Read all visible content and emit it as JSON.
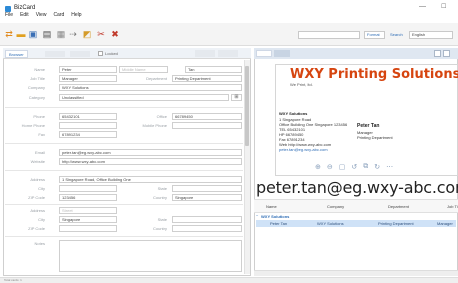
{
  "window": {
    "title": "BizCard",
    "minimize": "—",
    "maximize": "☐"
  },
  "menu": [
    "File",
    "Edit",
    "View",
    "Card",
    "Help"
  ],
  "toolbar": {
    "dropdown_value": "",
    "toggle_label": "Format",
    "search_label": "Search",
    "language": "English"
  },
  "left_tabs": [
    {
      "label": "Browser",
      "active": true
    },
    {
      "label": "",
      "active": false
    },
    {
      "label": "",
      "active": false
    },
    {
      "label": "Locked",
      "active": false
    }
  ],
  "form": {
    "name_label": "Name",
    "first_name": "Peter",
    "middle_name_placeholder": "Middle Name",
    "last_name": "Tan",
    "job_title_label": "Job Title",
    "job_title": "Manager",
    "department_label": "Department",
    "department": "Printing Department",
    "company_label": "Company",
    "company": "WXY Solutions",
    "category_label": "Category",
    "category": "Unclassified",
    "phone_label": "Phone",
    "phone": "65432101",
    "office_label": "Office",
    "office": "66789450",
    "home_phone_label": "Home Phone",
    "mobile_label": "Mobile Phone",
    "fax_label": "Fax",
    "fax": "67891234",
    "email_label": "Email",
    "email": "peter.tan@eg.wxy-abc.com",
    "website_label": "Website",
    "website": "http://www.wxy-abc.com",
    "address_label": "Address",
    "address": "1 Singapore Road, Office Building One",
    "city_label": "City",
    "state_label": "State",
    "zip_label": "ZIP Code",
    "zip": "123456",
    "country_label": "Country",
    "country": "Singapore",
    "address2_label": "Address",
    "address2_placeholder": "Street",
    "city2": "Singapore",
    "notes_label": "Notes"
  },
  "card": {
    "title": "WXY Printing Solutions",
    "subtitle": "We Print, ltd.",
    "company": "WXY Solutions",
    "addr1": "1 Singapore Road",
    "addr2": "Office Building One Singapore 123456",
    "tel": "TEL  65432101",
    "hp": "HP   66789450",
    "fax": "Fax  67891234",
    "web": "Web  http://www.wxy-abc.com",
    "email": "peter.tan@eg.wxy-abc.com",
    "name": "Peter Tan",
    "role": "Manager",
    "dept": "Printing Department"
  },
  "big_email": "peter.tan@eg.wxy-abc.com",
  "grid": {
    "headers": [
      "Name",
      "Company",
      "Department",
      "Job Ti"
    ],
    "group": "WXY Solutions",
    "row": [
      "Peter Tan",
      "WXY Solutions",
      "Printing Department",
      "Manager"
    ]
  },
  "status": "Total cards: 1"
}
